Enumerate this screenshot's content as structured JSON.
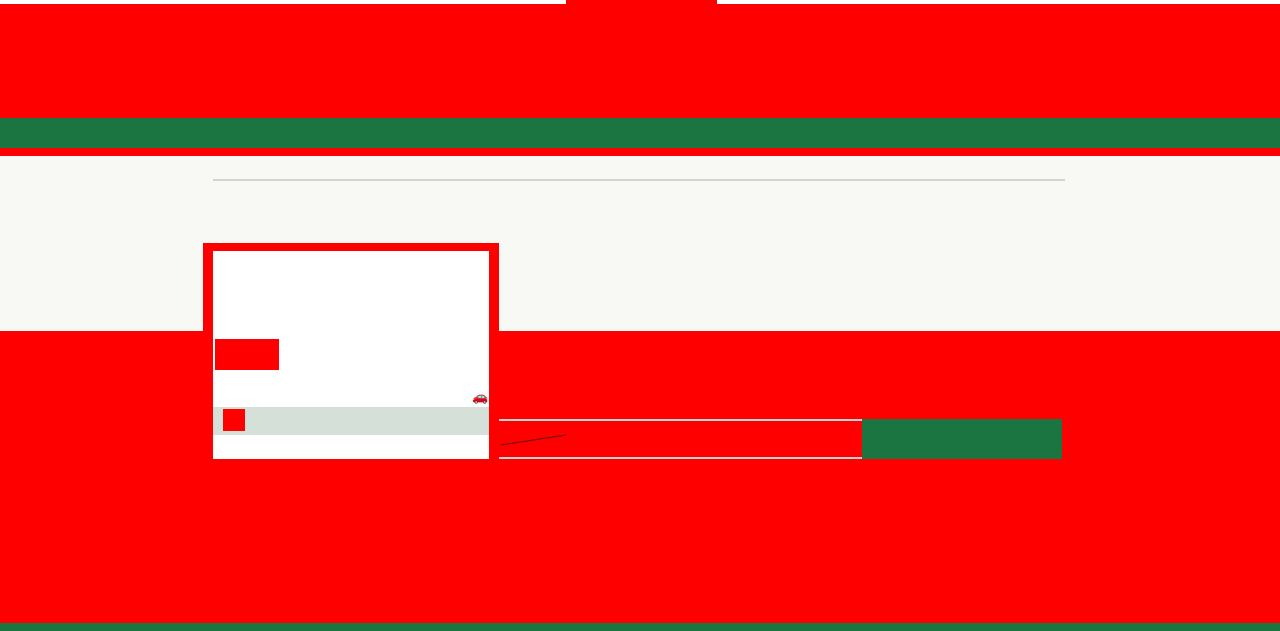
{
  "colors": {
    "primary_red": "#ff0000",
    "brand_green": "#1a7540",
    "band_background": "#f8f8f4",
    "card_bar": "#d4e0d8",
    "rule_gray": "#d4d4d4",
    "white": "#ffffff"
  },
  "card": {
    "icon": "car-icon",
    "icon_glyph": "🚗"
  },
  "search": {
    "value": "",
    "placeholder": "",
    "button_label": ""
  }
}
